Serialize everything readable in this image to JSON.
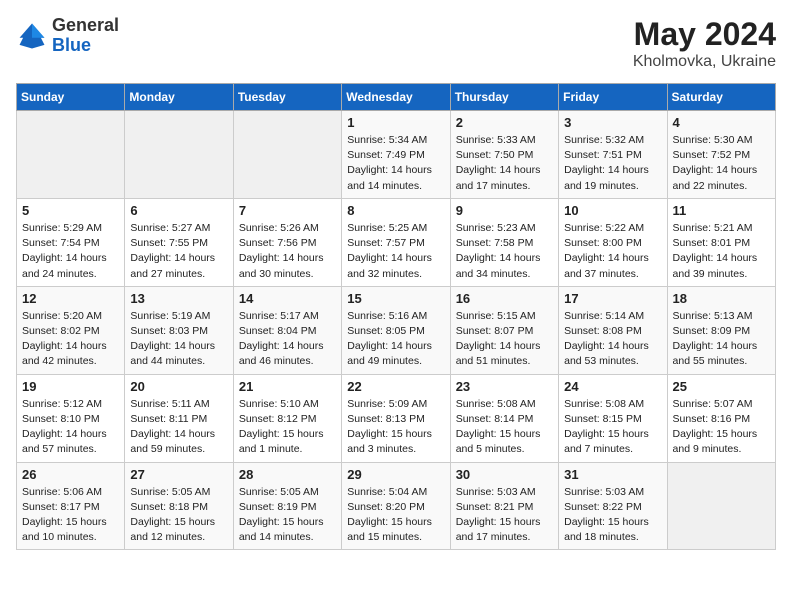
{
  "header": {
    "logo_general": "General",
    "logo_blue": "Blue",
    "month_year": "May 2024",
    "location": "Kholmovka, Ukraine"
  },
  "days_of_week": [
    "Sunday",
    "Monday",
    "Tuesday",
    "Wednesday",
    "Thursday",
    "Friday",
    "Saturday"
  ],
  "weeks": [
    [
      {
        "day": "",
        "info": ""
      },
      {
        "day": "",
        "info": ""
      },
      {
        "day": "",
        "info": ""
      },
      {
        "day": "1",
        "info": "Sunrise: 5:34 AM\nSunset: 7:49 PM\nDaylight: 14 hours\nand 14 minutes."
      },
      {
        "day": "2",
        "info": "Sunrise: 5:33 AM\nSunset: 7:50 PM\nDaylight: 14 hours\nand 17 minutes."
      },
      {
        "day": "3",
        "info": "Sunrise: 5:32 AM\nSunset: 7:51 PM\nDaylight: 14 hours\nand 19 minutes."
      },
      {
        "day": "4",
        "info": "Sunrise: 5:30 AM\nSunset: 7:52 PM\nDaylight: 14 hours\nand 22 minutes."
      }
    ],
    [
      {
        "day": "5",
        "info": "Sunrise: 5:29 AM\nSunset: 7:54 PM\nDaylight: 14 hours\nand 24 minutes."
      },
      {
        "day": "6",
        "info": "Sunrise: 5:27 AM\nSunset: 7:55 PM\nDaylight: 14 hours\nand 27 minutes."
      },
      {
        "day": "7",
        "info": "Sunrise: 5:26 AM\nSunset: 7:56 PM\nDaylight: 14 hours\nand 30 minutes."
      },
      {
        "day": "8",
        "info": "Sunrise: 5:25 AM\nSunset: 7:57 PM\nDaylight: 14 hours\nand 32 minutes."
      },
      {
        "day": "9",
        "info": "Sunrise: 5:23 AM\nSunset: 7:58 PM\nDaylight: 14 hours\nand 34 minutes."
      },
      {
        "day": "10",
        "info": "Sunrise: 5:22 AM\nSunset: 8:00 PM\nDaylight: 14 hours\nand 37 minutes."
      },
      {
        "day": "11",
        "info": "Sunrise: 5:21 AM\nSunset: 8:01 PM\nDaylight: 14 hours\nand 39 minutes."
      }
    ],
    [
      {
        "day": "12",
        "info": "Sunrise: 5:20 AM\nSunset: 8:02 PM\nDaylight: 14 hours\nand 42 minutes."
      },
      {
        "day": "13",
        "info": "Sunrise: 5:19 AM\nSunset: 8:03 PM\nDaylight: 14 hours\nand 44 minutes."
      },
      {
        "day": "14",
        "info": "Sunrise: 5:17 AM\nSunset: 8:04 PM\nDaylight: 14 hours\nand 46 minutes."
      },
      {
        "day": "15",
        "info": "Sunrise: 5:16 AM\nSunset: 8:05 PM\nDaylight: 14 hours\nand 49 minutes."
      },
      {
        "day": "16",
        "info": "Sunrise: 5:15 AM\nSunset: 8:07 PM\nDaylight: 14 hours\nand 51 minutes."
      },
      {
        "day": "17",
        "info": "Sunrise: 5:14 AM\nSunset: 8:08 PM\nDaylight: 14 hours\nand 53 minutes."
      },
      {
        "day": "18",
        "info": "Sunrise: 5:13 AM\nSunset: 8:09 PM\nDaylight: 14 hours\nand 55 minutes."
      }
    ],
    [
      {
        "day": "19",
        "info": "Sunrise: 5:12 AM\nSunset: 8:10 PM\nDaylight: 14 hours\nand 57 minutes."
      },
      {
        "day": "20",
        "info": "Sunrise: 5:11 AM\nSunset: 8:11 PM\nDaylight: 14 hours\nand 59 minutes."
      },
      {
        "day": "21",
        "info": "Sunrise: 5:10 AM\nSunset: 8:12 PM\nDaylight: 15 hours\nand 1 minute."
      },
      {
        "day": "22",
        "info": "Sunrise: 5:09 AM\nSunset: 8:13 PM\nDaylight: 15 hours\nand 3 minutes."
      },
      {
        "day": "23",
        "info": "Sunrise: 5:08 AM\nSunset: 8:14 PM\nDaylight: 15 hours\nand 5 minutes."
      },
      {
        "day": "24",
        "info": "Sunrise: 5:08 AM\nSunset: 8:15 PM\nDaylight: 15 hours\nand 7 minutes."
      },
      {
        "day": "25",
        "info": "Sunrise: 5:07 AM\nSunset: 8:16 PM\nDaylight: 15 hours\nand 9 minutes."
      }
    ],
    [
      {
        "day": "26",
        "info": "Sunrise: 5:06 AM\nSunset: 8:17 PM\nDaylight: 15 hours\nand 10 minutes."
      },
      {
        "day": "27",
        "info": "Sunrise: 5:05 AM\nSunset: 8:18 PM\nDaylight: 15 hours\nand 12 minutes."
      },
      {
        "day": "28",
        "info": "Sunrise: 5:05 AM\nSunset: 8:19 PM\nDaylight: 15 hours\nand 14 minutes."
      },
      {
        "day": "29",
        "info": "Sunrise: 5:04 AM\nSunset: 8:20 PM\nDaylight: 15 hours\nand 15 minutes."
      },
      {
        "day": "30",
        "info": "Sunrise: 5:03 AM\nSunset: 8:21 PM\nDaylight: 15 hours\nand 17 minutes."
      },
      {
        "day": "31",
        "info": "Sunrise: 5:03 AM\nSunset: 8:22 PM\nDaylight: 15 hours\nand 18 minutes."
      },
      {
        "day": "",
        "info": ""
      }
    ]
  ]
}
